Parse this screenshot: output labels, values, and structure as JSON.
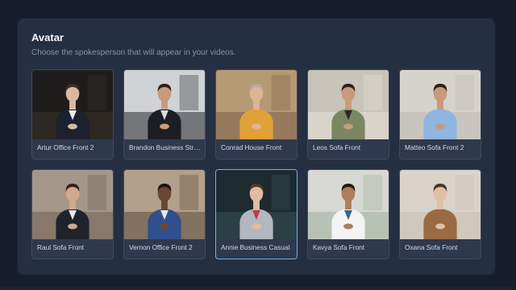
{
  "section": {
    "title": "Avatar",
    "subtitle": "Choose the spokesperson that will appear in your videos."
  },
  "avatars": [
    {
      "label": "Artur Office Front 2",
      "selected": false,
      "bg": "#1e1d1c",
      "accent": "#3a3128",
      "skin": "#d9b99f",
      "hair": "#3b2e24",
      "outfit": "#1c2130",
      "shirt": "#e9ecef"
    },
    {
      "label": "Brandon Business Street",
      "selected": false,
      "bg": "#cfd3d6",
      "accent": "#2a2c2f",
      "skin": "#c99a7b",
      "hair": "#2b211b",
      "outfit": "#1b1e24",
      "shirt": "#d8dbde"
    },
    {
      "label": "Conrad House Front",
      "selected": false,
      "bg": "#b59a74",
      "accent": "#7d6148",
      "skin": "#dcb598",
      "hair": "#b7a898",
      "outfit": "#e0a236",
      "shirt": "#e0a236"
    },
    {
      "label": "Leos Sofa Front",
      "selected": false,
      "bg": "#c9c4ba",
      "accent": "#e6e1d7",
      "skin": "#c99c7c",
      "hair": "#2a2019",
      "outfit": "#7b8663",
      "shirt": "#25282c"
    },
    {
      "label": "Matteo Sofa Front 2",
      "selected": false,
      "bg": "#d6d3cc",
      "accent": "#bfbab1",
      "skin": "#c89a7a",
      "hair": "#2b2119",
      "outfit": "#8fb6e0",
      "shirt": "#8fb6e0"
    },
    {
      "label": "Raul Sofa Front",
      "selected": false,
      "bg": "#a4978a",
      "accent": "#6f5f52",
      "skin": "#d2a88a",
      "hair": "#2c231c",
      "outfit": "#1f232b",
      "shirt": "#e7e7e7"
    },
    {
      "label": "Vernon Office Front 2",
      "selected": false,
      "bg": "#b2a08a",
      "accent": "#5b4a3b",
      "skin": "#6b4634",
      "hair": "#1d1612",
      "outfit": "#2f4f8e",
      "shirt": "#e6e6e6"
    },
    {
      "label": "Annie Business Casual",
      "selected": true,
      "bg": "#1d2a30",
      "accent": "#38505a",
      "skin": "#e0bca4",
      "hair": "#5c3a26",
      "outfit": "#b3b8bf",
      "shirt": "#c23a4a"
    },
    {
      "label": "Kavya Sofa Front",
      "selected": false,
      "bg": "#d7d8d3",
      "accent": "#9fb09a",
      "skin": "#b07c5e",
      "hair": "#221913",
      "outfit": "#f3f3f3",
      "shirt": "#3d5f8a"
    },
    {
      "label": "Oxana Sofa Front",
      "selected": false,
      "bg": "#d9d3c9",
      "accent": "#c8bfb1",
      "skin": "#e1bea6",
      "hair": "#4c3426",
      "outfit": "#9a6a44",
      "shirt": "#9a6a44"
    }
  ]
}
